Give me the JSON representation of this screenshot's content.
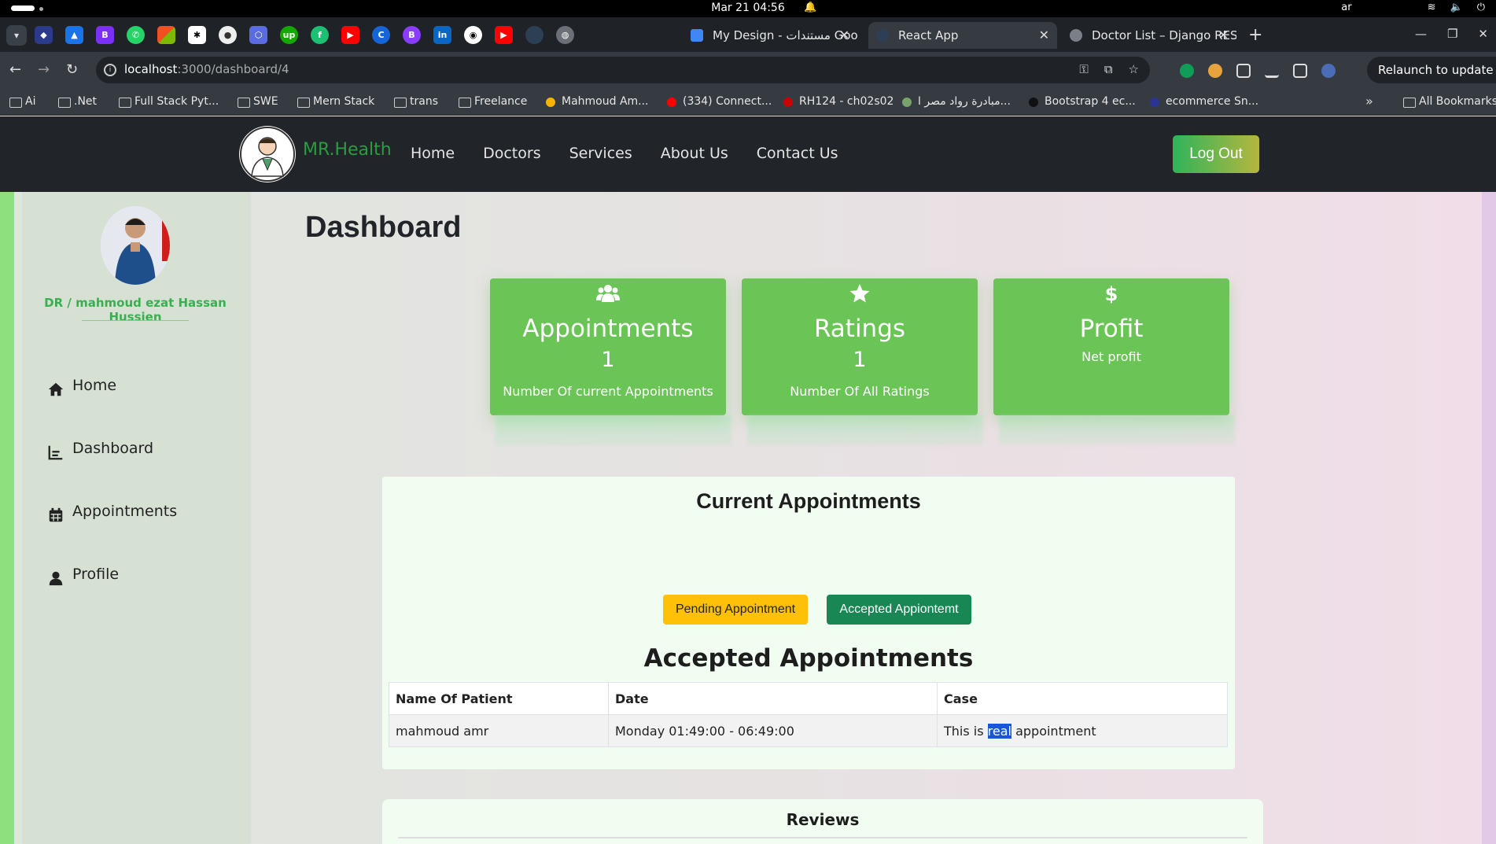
{
  "os": {
    "clock": "Mar 21  04:56",
    "lang": "ar"
  },
  "browser": {
    "tabs": [
      {
        "title": "My Design - مستندات Goo",
        "active": false
      },
      {
        "title": "React App",
        "active": true
      },
      {
        "title": "Doctor List – Django RES",
        "active": false
      }
    ],
    "url_host": "localhost",
    "url_path": ":3000/dashboard/4",
    "relaunch_label": "Relaunch to update",
    "bookmarks": [
      "Ai",
      ".Net",
      "Full Stack Pyt...",
      "SWE",
      "Mern Stack",
      "trans",
      "Freelance",
      "Mahmoud Am...",
      "(334) Connect...",
      "RH124 - ch02s02",
      "مبادرة رواد مصر ا...",
      "Bootstrap 4 ec...",
      "ecommerce Sn...",
      "All Bookmarks"
    ],
    "bookmark_overflow": "»"
  },
  "navbar": {
    "brand": "MR.Health",
    "links": [
      "Home",
      "Doctors",
      "Services",
      "About Us",
      "Contact Us"
    ],
    "logout_label": "Log Out"
  },
  "sidebar": {
    "doctor_name": "DR / mahmoud ezat Hassan Hussien",
    "items": [
      {
        "label": "Home",
        "icon": "home-icon"
      },
      {
        "label": "Dashboard",
        "icon": "chart-icon"
      },
      {
        "label": "Appointments",
        "icon": "calendar-icon"
      },
      {
        "label": "Profile",
        "icon": "user-icon"
      }
    ]
  },
  "dashboard": {
    "title": "Dashboard",
    "cards": [
      {
        "title": "Appointments",
        "value": "1",
        "subtitle": "Number Of current Appointments",
        "icon": "users-icon"
      },
      {
        "title": "Ratings",
        "value": "1",
        "subtitle": "Number Of All Ratings",
        "icon": "star-icon"
      },
      {
        "title": "Profit",
        "value": "",
        "subtitle": "Net profit",
        "icon": "dollar-icon"
      }
    ],
    "current_appointments_title": "Current Appointments",
    "pending_button": "Pending Appointment",
    "accepted_button": "Accepted Appiontemt",
    "accepted_title": "Accepted Appointments",
    "table": {
      "headers": [
        "Name Of Patient",
        "Date",
        "Case"
      ],
      "rows": [
        {
          "patient": "mahmoud amr",
          "date": "Monday 01:49:00 - 06:49:00",
          "case_before": "This is ",
          "case_highlight": "real",
          "case_after": " appointment"
        }
      ]
    },
    "reviews_title": "Reviews"
  },
  "colors": {
    "card_green": "#6ac456",
    "brand_green": "#2a9d3f",
    "pending_yellow": "#ffc107",
    "accepted_green": "#198754"
  }
}
